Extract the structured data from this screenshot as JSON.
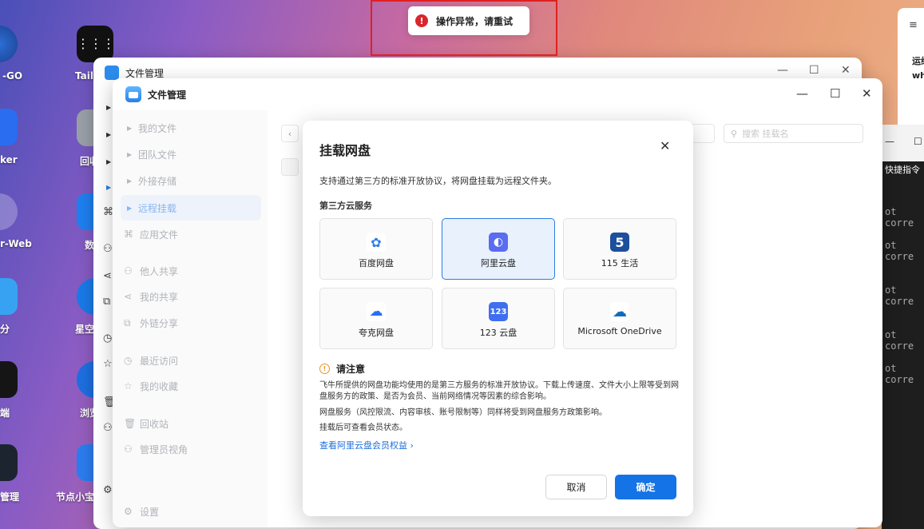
{
  "toast": {
    "message": "操作异常，请重试",
    "icon": "error-icon"
  },
  "desktop": {
    "left_labels": [
      "-GO",
      "ker",
      "r-Web",
      "分",
      "端",
      "管理"
    ],
    "col2_labels": [
      "Tails",
      "回收",
      "数",
      "星空",
      "浏览",
      "节点小宝"
    ]
  },
  "side_panel": {
    "line1": "运维",
    "line2": "wh"
  },
  "terminal": {
    "quick_cmd": "快捷指令",
    "lines": [
      "ot corre",
      "ot corre",
      "ot corre",
      "ot corre",
      "ot corre"
    ]
  },
  "window_back": {
    "title": "文件管理"
  },
  "window": {
    "title": "文件管理",
    "search_placeholder": "搜索 挂载名",
    "nav": [
      {
        "label": "我的文件",
        "kind": "arrow"
      },
      {
        "label": "团队文件",
        "kind": "arrow"
      },
      {
        "label": "外接存储",
        "kind": "arrow"
      },
      {
        "label": "远程挂载",
        "kind": "arrow",
        "active": true
      },
      {
        "label": "应用文件",
        "kind": "icon",
        "icon": "apps-icon"
      },
      {
        "label": "他人共享",
        "kind": "icon",
        "icon": "users-icon"
      },
      {
        "label": "我的共享",
        "kind": "icon",
        "icon": "share-icon"
      },
      {
        "label": "外链分享",
        "kind": "icon",
        "icon": "external-link-icon"
      },
      {
        "label": "最近访问",
        "kind": "icon",
        "icon": "clock-icon"
      },
      {
        "label": "我的收藏",
        "kind": "icon",
        "icon": "star-icon"
      },
      {
        "label": "回收站",
        "kind": "icon",
        "icon": "trash-icon"
      },
      {
        "label": "管理员视角",
        "kind": "icon",
        "icon": "admin-icon"
      },
      {
        "label": "设置",
        "kind": "icon",
        "icon": "gear-icon"
      }
    ]
  },
  "dialog": {
    "title": "挂载网盘",
    "description": "支持通过第三方的标准开放协议，将网盘挂载为远程文件夹。",
    "section_title": "第三方云服务",
    "services": [
      {
        "name": "百度网盘",
        "icon": "baidu-netdisk-icon",
        "color": "#ffffff",
        "glyph": "✿",
        "glyph_color": "#2f7be8"
      },
      {
        "name": "阿里云盘",
        "icon": "aliyun-drive-icon",
        "color": "#5a6cf0",
        "glyph": "◐",
        "glyph_color": "#ffffff",
        "selected": true
      },
      {
        "name": "115 生活",
        "icon": "115-icon",
        "color": "#1c4f9c",
        "glyph": "5",
        "glyph_color": "#ffffff"
      },
      {
        "name": "夸克网盘",
        "icon": "quark-drive-icon",
        "color": "#ffffff",
        "glyph": "☁",
        "glyph_color": "#2a6ef5"
      },
      {
        "name": "123 云盘",
        "icon": "123-drive-icon",
        "color": "#3f6ff0",
        "glyph": "123",
        "glyph_color": "#ffffff"
      },
      {
        "name": "Microsoft OneDrive",
        "icon": "onedrive-icon",
        "color": "#ffffff",
        "glyph": "☁",
        "glyph_color": "#0f6cbd"
      }
    ],
    "note_title": "请注意",
    "note_lines": [
      "飞牛所提供的网盘功能均使用的是第三方服务的标准开放协议。下载上传速度、文件大小上限等受到网盘服务方的政策、是否为会员、当前网络情况等因素的综合影响。",
      "网盘服务（风控限流、内容审核、账号限制等）同样将受到网盘服务方政策影响。",
      "挂载后可查看会员状态。"
    ],
    "link": "查看阿里云盘会员权益 ›",
    "cancel_label": "取消",
    "ok_label": "确定"
  }
}
